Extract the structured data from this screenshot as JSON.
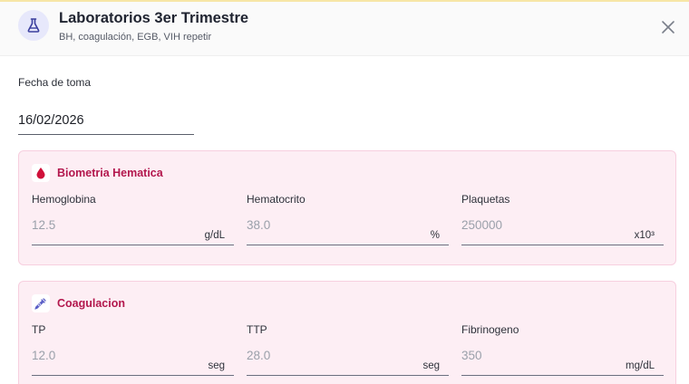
{
  "header": {
    "title": "Laboratorios 3er Trimestre",
    "subtitle": "BH, coagulación, EGB, VIH repetir",
    "icon": "flask-icon",
    "close_icon": "close-icon"
  },
  "date": {
    "label": "Fecha de toma",
    "value": "16/02/2026"
  },
  "sections": [
    {
      "title": "Biometria Hematica",
      "icon": "blood-drop-icon",
      "fields": [
        {
          "label": "Hemoglobina",
          "placeholder": "12.5",
          "unit": "g/dL"
        },
        {
          "label": "Hematocrito",
          "placeholder": "38.0",
          "unit": "%"
        },
        {
          "label": "Plaquetas",
          "placeholder": "250000",
          "unit": "x10³"
        }
      ]
    },
    {
      "title": "Coagulacion",
      "icon": "syringe-icon",
      "fields": [
        {
          "label": "TP",
          "placeholder": "12.0",
          "unit": "seg"
        },
        {
          "label": "TTP",
          "placeholder": "28.0",
          "unit": "seg"
        },
        {
          "label": "Fibrinogeno",
          "placeholder": "350",
          "unit": "mg/dL"
        }
      ]
    }
  ],
  "colors": {
    "accent": "#b3174d",
    "section_bg": "#fdeef4",
    "section_border": "#f7cfdf",
    "header_icon_bg": "#e7e8fb",
    "top_accent": "#f7e6a6"
  }
}
